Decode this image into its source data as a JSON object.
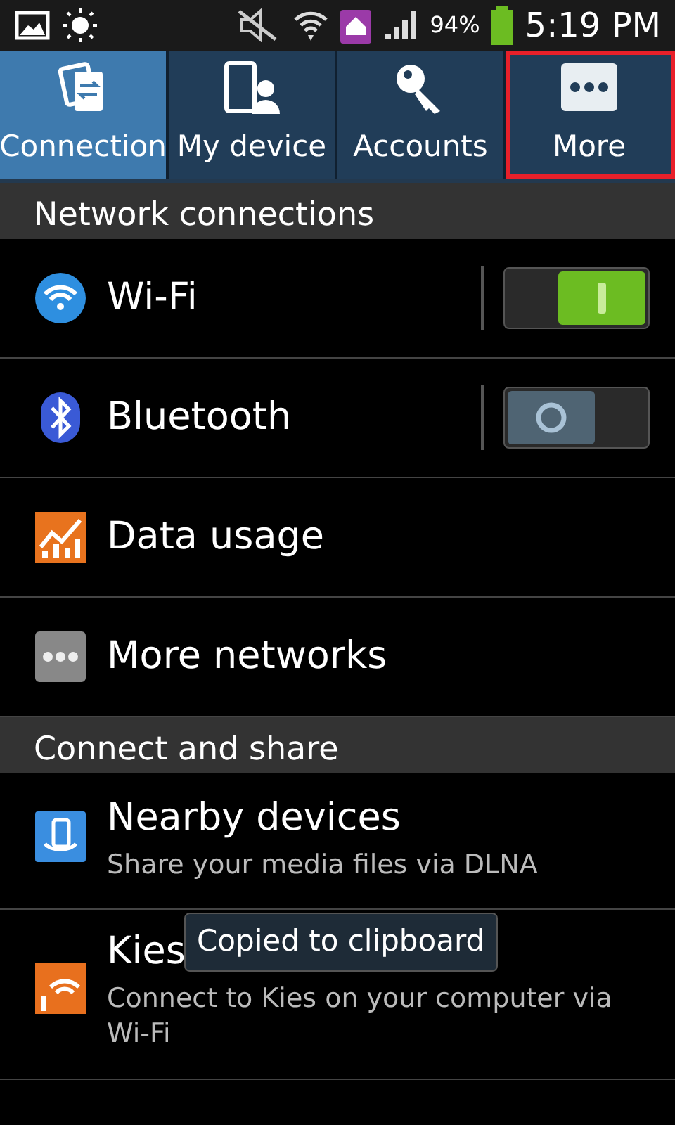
{
  "status_bar": {
    "battery": "94%",
    "time": "5:19 PM"
  },
  "tabs": [
    {
      "label": "Connection",
      "selected": true,
      "highlighted": false
    },
    {
      "label": "My device",
      "selected": false,
      "highlighted": false
    },
    {
      "label": "Accounts",
      "selected": false,
      "highlighted": false
    },
    {
      "label": "More",
      "selected": false,
      "highlighted": true
    }
  ],
  "sections": [
    {
      "header": "Network connections",
      "items": [
        {
          "kind": "toggle",
          "title": "Wi-Fi",
          "on": true
        },
        {
          "kind": "toggle",
          "title": "Bluetooth",
          "on": false
        },
        {
          "kind": "plain",
          "title": "Data usage"
        },
        {
          "kind": "plain",
          "title": "More networks"
        }
      ]
    },
    {
      "header": "Connect and share",
      "items": [
        {
          "kind": "sub",
          "title": "Nearby devices",
          "subtitle": "Share your media files via DLNA"
        },
        {
          "kind": "sub",
          "title": "Kies",
          "subtitle": "Connect to Kies on your computer via Wi-Fi"
        }
      ]
    }
  ],
  "toast": "Copied to clipboard"
}
